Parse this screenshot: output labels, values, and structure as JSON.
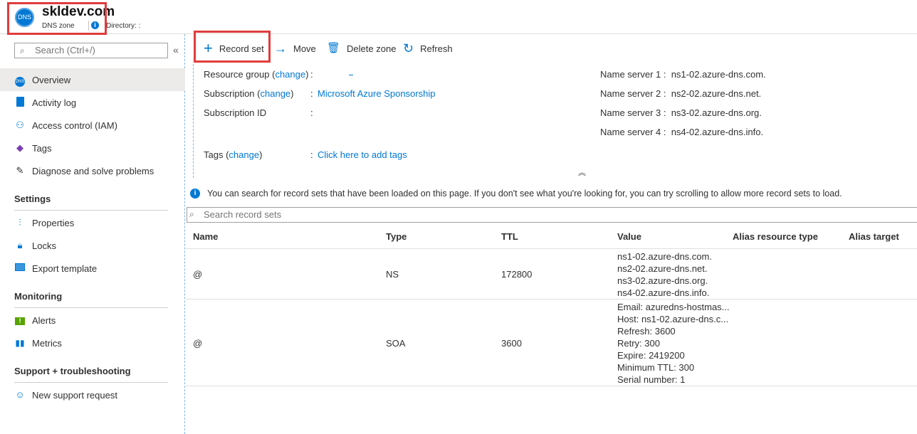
{
  "header": {
    "logo_text": "DNS",
    "title": "skldev.com",
    "subtitle": "DNS zone",
    "info_glyph": "i",
    "directory_label": "Directory: :",
    "highlight_color": "#e03c3c"
  },
  "sidebar": {
    "search_placeholder": "Search (Ctrl+/)",
    "collapse_glyph": "«",
    "items_top": [
      {
        "label": "Overview",
        "icon": "dns-icon"
      },
      {
        "label": "Activity log",
        "icon": "activity-log-icon"
      },
      {
        "label": "Access control (IAM)",
        "icon": "people-icon"
      },
      {
        "label": "Tags",
        "icon": "tag-icon"
      },
      {
        "label": "Diagnose and solve problems",
        "icon": "wrench-icon"
      }
    ],
    "settings": {
      "title": "Settings",
      "items": [
        {
          "label": "Properties",
          "icon": "properties-icon"
        },
        {
          "label": "Locks",
          "icon": "lock-icon"
        },
        {
          "label": "Export template",
          "icon": "export-template-icon"
        }
      ]
    },
    "monitoring": {
      "title": "Monitoring",
      "items": [
        {
          "label": "Alerts",
          "icon": "alert-icon"
        },
        {
          "label": "Metrics",
          "icon": "metrics-icon"
        }
      ]
    },
    "support": {
      "title": "Support + troubleshooting",
      "items": [
        {
          "label": "New support request",
          "icon": "support-icon"
        }
      ]
    }
  },
  "toolbar": {
    "record_set": "Record set",
    "move": "Move",
    "delete_zone": "Delete zone",
    "refresh": "Refresh"
  },
  "essentials": {
    "resource_group_label": "Resource group",
    "subscription_label": "Subscription",
    "subscription_id_label": "Subscription ID",
    "tags_label": "Tags",
    "change_link": "change",
    "colon": ":",
    "subscription_value": "Microsoft Azure Sponsorship",
    "tags_value": "Click here to add tags",
    "name_servers": [
      {
        "label": "Name server 1",
        "value": "ns1-02.azure-dns.com."
      },
      {
        "label": "Name server 2",
        "value": "ns2-02.azure-dns.net."
      },
      {
        "label": "Name server 3",
        "value": "ns3-02.azure-dns.org."
      },
      {
        "label": "Name server 4",
        "value": "ns4-02.azure-dns.info."
      }
    ],
    "collapse_glyph": "︽"
  },
  "info_bar": {
    "text": "You can search for record sets that have been loaded on this page. If you don't see what you're looking for, you can try scrolling to allow more record sets to load."
  },
  "record_search": {
    "placeholder": "Search record sets"
  },
  "table": {
    "columns": [
      "Name",
      "Type",
      "TTL",
      "Value",
      "Alias resource type",
      "Alias target"
    ],
    "rows": [
      {
        "name": "@",
        "type": "NS",
        "ttl": "172800",
        "value": [
          "ns1-02.azure-dns.com.",
          "ns2-02.azure-dns.net.",
          "ns3-02.azure-dns.org.",
          "ns4-02.azure-dns.info."
        ]
      },
      {
        "name": "@",
        "type": "SOA",
        "ttl": "3600",
        "value": [
          "Email: azuredns-hostmas...",
          "Host: ns1-02.azure-dns.c...",
          "Refresh: 3600",
          "Retry: 300",
          "Expire: 2419200",
          "Minimum TTL: 300",
          "Serial number: 1"
        ]
      }
    ]
  }
}
